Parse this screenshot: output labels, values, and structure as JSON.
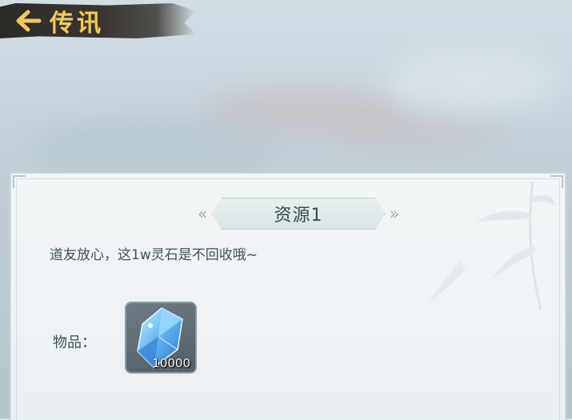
{
  "header": {
    "title": "传讯",
    "back_icon": "back-arrow-icon"
  },
  "mail": {
    "title": "资源1",
    "message": "道友放心，这1w灵石是不回收哦~",
    "items_label": "物品：",
    "items": [
      {
        "icon": "spirit-stone-crystal-icon",
        "quantity": "10000"
      }
    ]
  },
  "colors": {
    "title_gold": "#f0c864",
    "panel_bg": "#eef3f5",
    "text": "#3f5158",
    "crystal": "#5fb4f0"
  }
}
